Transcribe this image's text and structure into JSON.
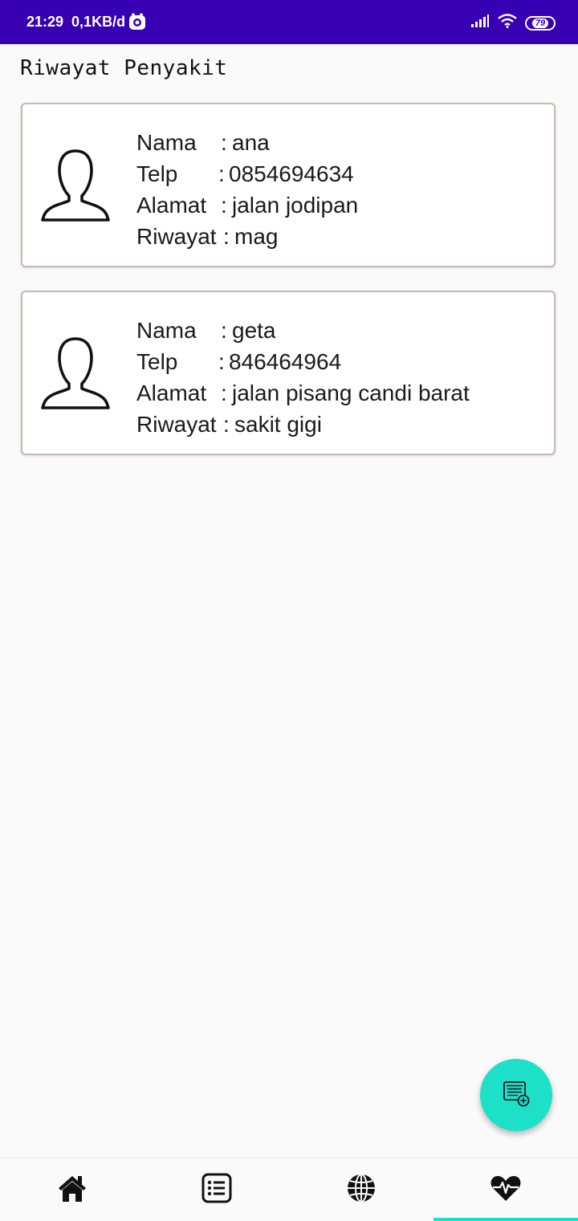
{
  "status_bar": {
    "time": "21:29",
    "network_speed": "0,1KB/d",
    "battery": "79"
  },
  "page": {
    "title": "Riwayat Penyakit"
  },
  "field_labels": {
    "nama": "Nama",
    "telp": "Telp",
    "alamat": "Alamat",
    "riwayat": "Riwayat",
    "separator": ":"
  },
  "records": [
    {
      "nama": "ana",
      "telp": "0854694634",
      "alamat": "jalan jodipan",
      "riwayat": "mag"
    },
    {
      "nama": "geta",
      "telp": "846464964",
      "alamat": "jalan pisang candi barat",
      "riwayat": "sakit gigi"
    }
  ],
  "fab": {
    "icon": "add-note-icon"
  },
  "bottom_nav": {
    "items": [
      {
        "icon": "home-icon"
      },
      {
        "icon": "list-icon"
      },
      {
        "icon": "globe-icon"
      },
      {
        "icon": "heartbeat-icon"
      }
    ],
    "active_index": 3
  },
  "colors": {
    "status_bar": "#3700b3",
    "accent": "#1de0c8",
    "card_border": "#c9b8b4",
    "background": "#fafafa"
  }
}
